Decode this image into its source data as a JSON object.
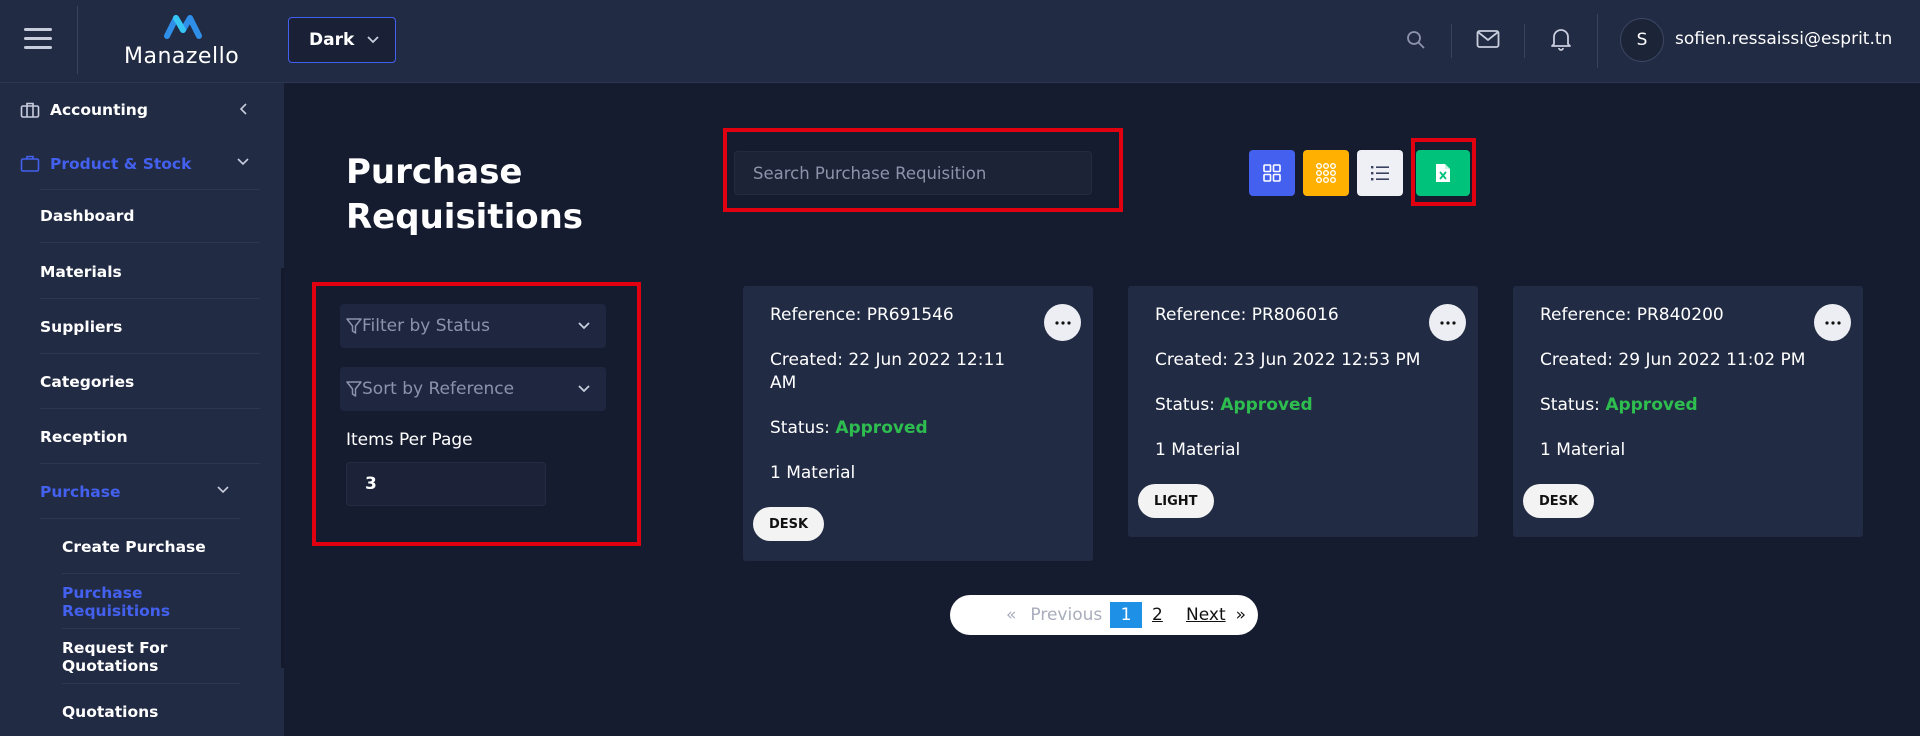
{
  "header": {
    "logo_text": "Manazello",
    "theme_value": "Dark",
    "avatar_initial": "S",
    "user_email": "sofien.ressaissi@esprit.tn"
  },
  "sidebar": {
    "items": [
      {
        "label": "Accounting"
      },
      {
        "label": "Product & Stock"
      },
      {
        "label": "Dashboard"
      },
      {
        "label": "Materials"
      },
      {
        "label": "Suppliers"
      },
      {
        "label": "Categories"
      },
      {
        "label": "Reception"
      },
      {
        "label": "Purchase"
      },
      {
        "label": "Create Purchase"
      },
      {
        "label": "Purchase Requisitions"
      },
      {
        "label": "Request For Quotations"
      },
      {
        "label": "Quotations"
      }
    ]
  },
  "main": {
    "title_line1": "Purchase",
    "title_line2": "Requisitions",
    "search_placeholder": "Search Purchase Requisition",
    "filter_status": "Filter by Status",
    "sort_reference": "Sort by Reference",
    "items_per_page_label": "Items Per Page",
    "items_per_page_value": "3",
    "status_label": "Status: ",
    "cards": [
      {
        "reference": "Reference: PR691546",
        "created_line1": "Created: 22 Jun 2022 12:11",
        "created_line2": "AM",
        "status": "Approved",
        "materials": "1 Material",
        "tag": "DESK"
      },
      {
        "reference": "Reference: PR806016",
        "created_line1": "Created: 23 Jun 2022 12:53 PM",
        "status": "Approved",
        "materials": "1 Material",
        "tag": "LIGHT"
      },
      {
        "reference": "Reference: PR840200",
        "created_line1": "Created: 29 Jun 2022 11:02 PM",
        "status": "Approved",
        "materials": "1 Material",
        "tag": "DESK"
      }
    ],
    "pagination": {
      "prev_symbol": "«",
      "previous": "Previous",
      "pages": [
        "1",
        "2"
      ],
      "next": "Next",
      "next_symbol": "»"
    }
  },
  "colors": {
    "accent": "#4361ee",
    "grid_btn": "#4361ee",
    "apps_btn": "#ffb000",
    "list_btn": "#eef0f6",
    "excel_btn": "#00c27a",
    "approved": "#2ebd4f",
    "highlight": "#e0000f"
  },
  "icons": [
    "menu-icon",
    "search-icon",
    "mail-icon",
    "bell-icon",
    "briefcase-icon",
    "cube-icon",
    "grid-icon",
    "apps-icon",
    "list-icon",
    "excel-icon",
    "filter-icon",
    "more-icon"
  ]
}
